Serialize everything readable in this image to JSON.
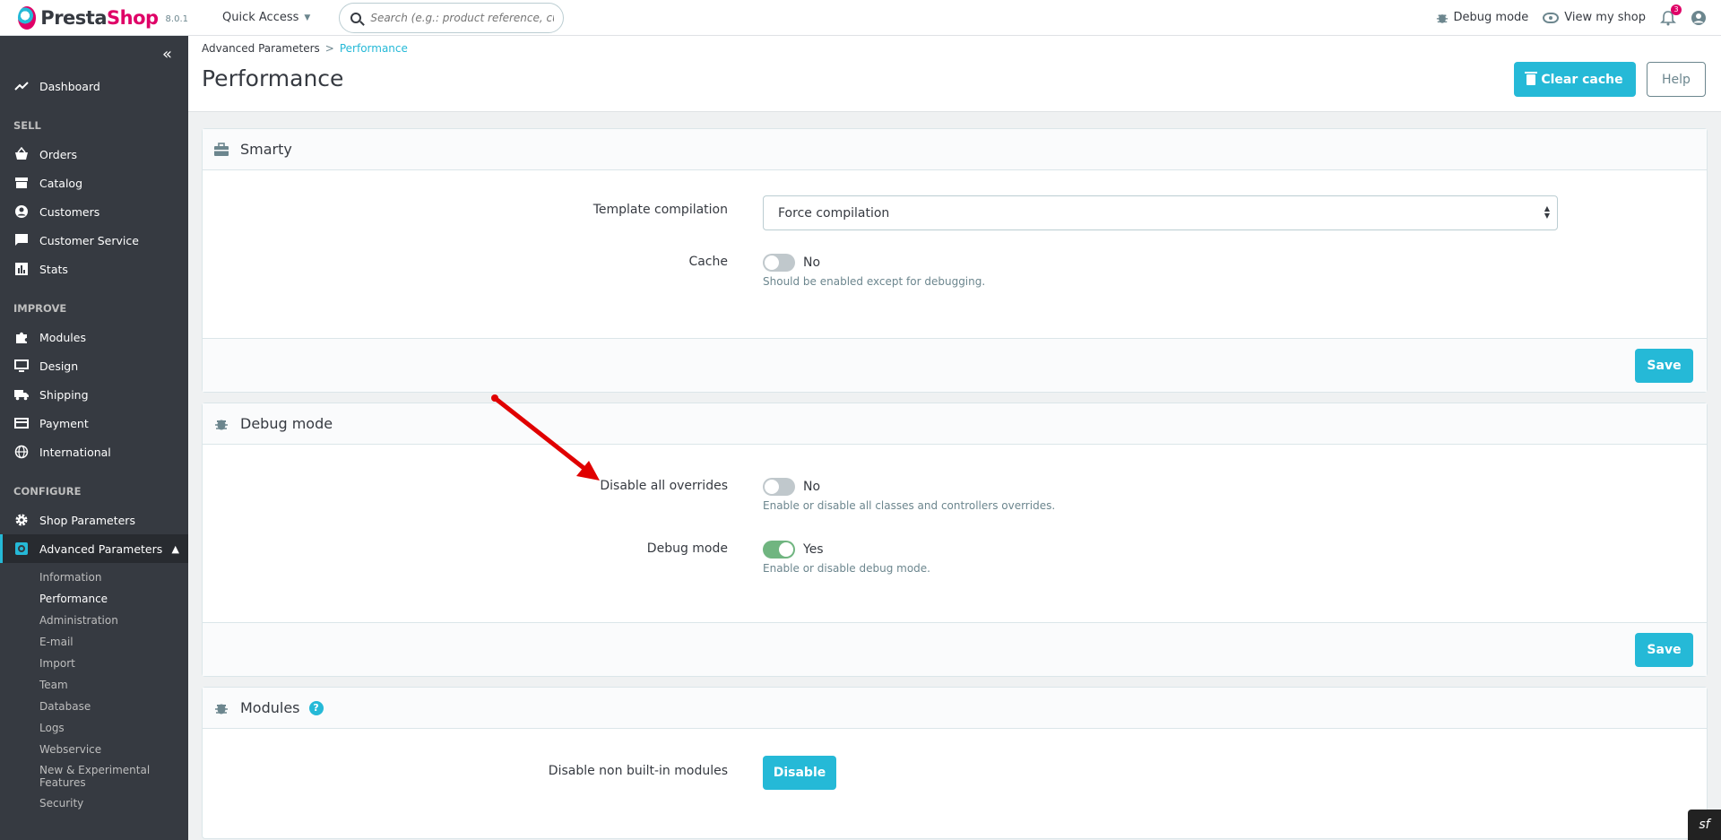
{
  "header": {
    "brand_main": "Presta",
    "brand_accent": "Shop",
    "version": "8.0.1",
    "quick_access": "Quick Access",
    "search_placeholder": "Search (e.g.: product reference, custon",
    "debug_mode": "Debug mode",
    "view_shop": "View my shop",
    "notifications_count": "3"
  },
  "sidebar": {
    "dashboard": "Dashboard",
    "sections": {
      "sell": "SELL",
      "improve": "IMPROVE",
      "configure": "CONFIGURE"
    },
    "sell_items": [
      "Orders",
      "Catalog",
      "Customers",
      "Customer Service",
      "Stats"
    ],
    "improve_items": [
      "Modules",
      "Design",
      "Shipping",
      "Payment",
      "International"
    ],
    "configure_items": [
      "Shop Parameters",
      "Advanced Parameters"
    ],
    "sub_items": [
      "Information",
      "Performance",
      "Administration",
      "E-mail",
      "Import",
      "Team",
      "Database",
      "Logs",
      "Webservice",
      "New & Experimental Features",
      "Security"
    ]
  },
  "page": {
    "breadcrumb_parent": "Advanced Parameters",
    "breadcrumb_current": "Performance",
    "title": "Performance",
    "clear_cache": "Clear cache",
    "help": "Help"
  },
  "smarty": {
    "title": "Smarty",
    "template_label": "Template compilation",
    "template_value": "Force compilation",
    "cache_label": "Cache",
    "cache_value": "No",
    "cache_help": "Should be enabled except for debugging.",
    "save": "Save"
  },
  "debug": {
    "title": "Debug mode",
    "overrides_label": "Disable all overrides",
    "overrides_value": "No",
    "overrides_help": "Enable or disable all classes and controllers overrides.",
    "debug_label": "Debug mode",
    "debug_value": "Yes",
    "debug_help": "Enable or disable debug mode.",
    "save": "Save"
  },
  "modules": {
    "title": "Modules",
    "help_badge": "?",
    "disable_label": "Disable non built-in modules",
    "disable_button": "Disable"
  },
  "colors": {
    "accent": "#25b9d7",
    "brand_pink": "#df0067",
    "sidebar_bg": "#363a41",
    "switch_on": "#70b580",
    "annotation_arrow": "#e00000"
  },
  "icons": [
    "search-icon",
    "bug-icon",
    "eye-icon",
    "bell-icon",
    "user-icon",
    "trash-icon",
    "briefcase-icon"
  ]
}
